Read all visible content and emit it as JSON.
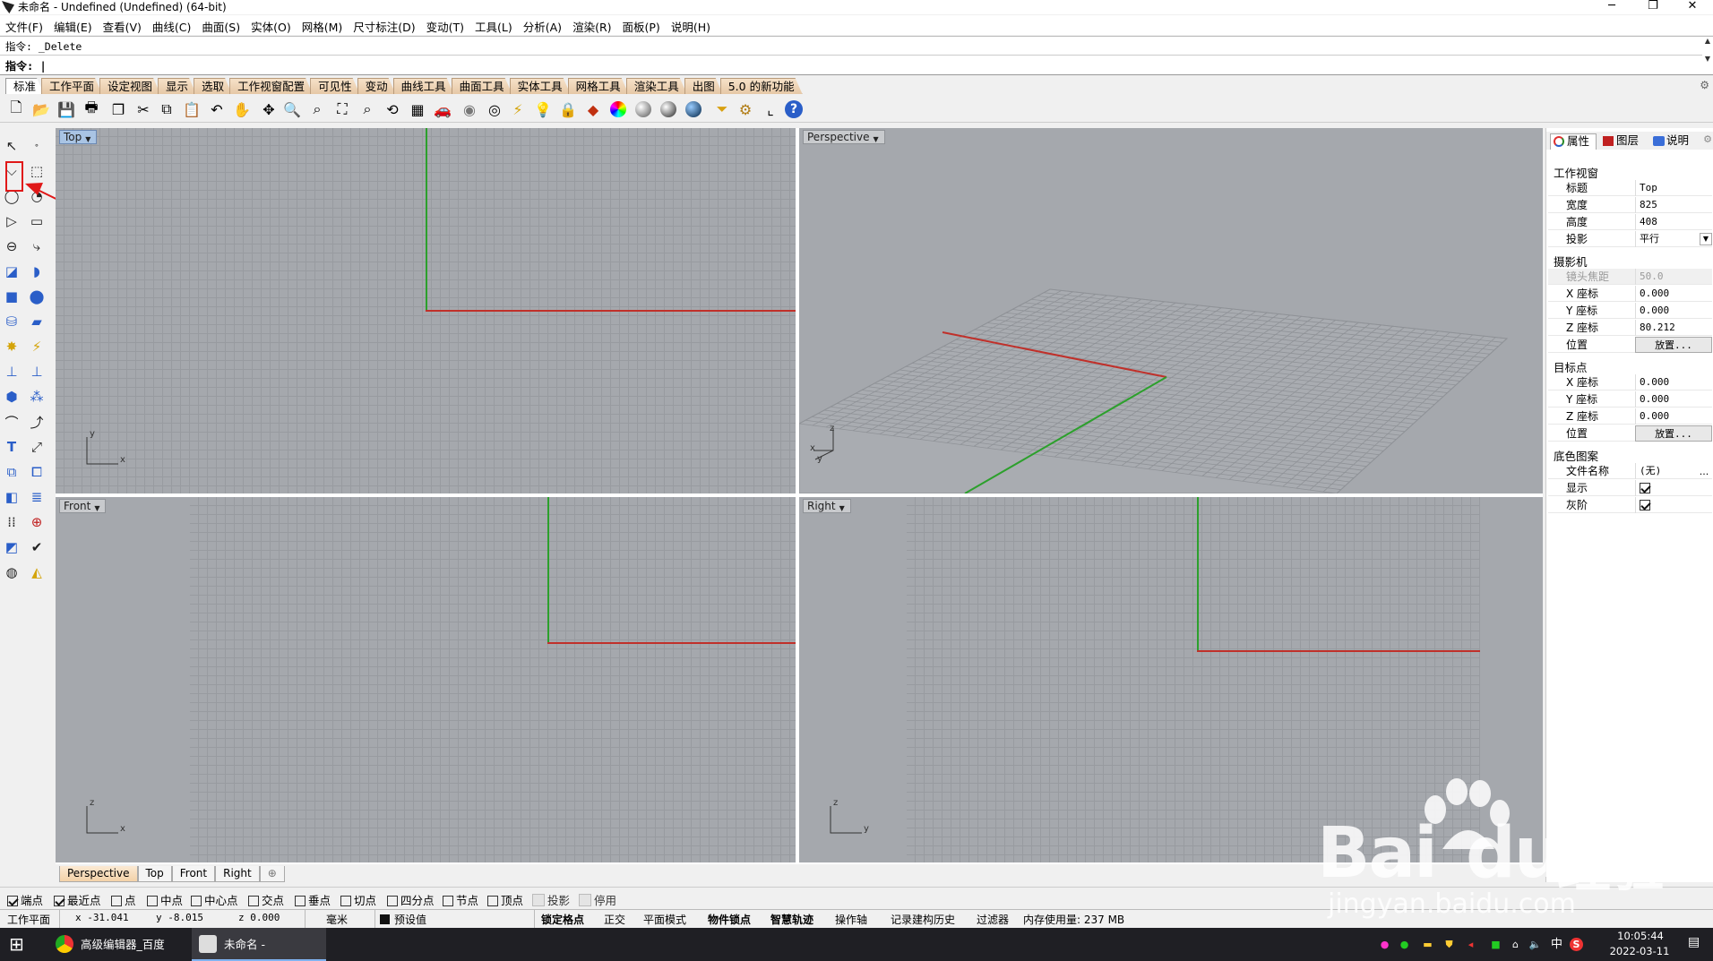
{
  "titlebar": {
    "title": "未命名 - Undefined (Undefined) (64-bit)",
    "minimize": "─",
    "maximize": "❐",
    "close": "✕"
  },
  "menu": [
    "文件(F)",
    "编辑(E)",
    "查看(V)",
    "曲线(C)",
    "曲面(S)",
    "实体(O)",
    "网格(M)",
    "尺寸标注(D)",
    "变动(T)",
    "工具(L)",
    "分析(A)",
    "渲染(R)",
    "面板(P)",
    "说明(H)"
  ],
  "command": {
    "history": "指令: _Delete",
    "prompt": "指令: |"
  },
  "toolbar_tabs": [
    "标准",
    "工作平面",
    "设定视图",
    "显示",
    "选取",
    "工作视窗配置",
    "可见性",
    "变动",
    "曲线工具",
    "曲面工具",
    "实体工具",
    "网格工具",
    "渲染工具",
    "出图",
    "5.0 的新功能"
  ],
  "toolbar_icons": [
    "new-file-icon",
    "open-folder-icon",
    "save-icon",
    "print-icon",
    "import-icon",
    "cut-icon",
    "copy-icon",
    "paste-icon",
    "undo-icon",
    "pan-hand-icon",
    "rotate-view-icon",
    "zoom-icon",
    "zoom-window-icon",
    "zoom-extents-icon",
    "zoom-selected-icon",
    "undo-view-icon",
    "four-viewports-icon",
    "car-icon",
    "hide-icon",
    "show-icon",
    "osnap-icon",
    "light-icon",
    "lock-icon",
    "layer-icon",
    "material-color-icon",
    "render-preview-icon",
    "render-icon",
    "render-blue-icon",
    "select-filter-icon",
    "options-gear-icon",
    "cplane-icon",
    "help-icon"
  ],
  "left_tools": [
    "select-arrow-icon",
    "point-icon",
    "polyline-icon",
    "control-points-curve-icon",
    "circle-icon",
    "arc-icon",
    "polygon-icon",
    "rectangle-icon",
    "ellipse-icon",
    "fillet-curve-icon",
    "surface-from-points-icon",
    "extrude-curve-icon",
    "box-icon",
    "sphere-group-icon",
    "cylinder-icon",
    "mesh-plane-icon",
    "boolean-union-icon",
    "explode-icon",
    "lineweight-icon",
    "dimension-icon",
    "split-icon",
    "join-icon",
    "fillet-icon",
    "chamfer-icon",
    "text-icon",
    "transform-icon",
    "array-icon",
    "group-icon",
    "block-icon",
    "layer-tool-icon",
    "grid-array-icon",
    "analyze-icon",
    "history-icon",
    "check-icon",
    "render-tool-icon",
    "light-tool-icon"
  ],
  "viewports": {
    "top": {
      "label": "Top",
      "axis_a": "y",
      "axis_b": "x"
    },
    "perspective": {
      "label": "Perspective",
      "axis_a": "z",
      "axis_b": "x",
      "axis_c": "y"
    },
    "front": {
      "label": "Front",
      "axis_a": "z",
      "axis_b": "x"
    },
    "right": {
      "label": "Right",
      "axis_a": "z",
      "axis_b": "y"
    }
  },
  "viewport_tabs": [
    "Perspective",
    "Top",
    "Front",
    "Right"
  ],
  "add_tab": "⊕",
  "panel": {
    "tabs": [
      "属性",
      "图层",
      "说明"
    ],
    "section_viewport": "工作视窗",
    "title_label": "标题",
    "title_value": "Top",
    "width_label": "宽度",
    "width_value": "825",
    "height_label": "高度",
    "height_value": "408",
    "projection_label": "投影",
    "projection_value": "平行",
    "section_camera": "摄影机",
    "lens_label": "镜头焦距",
    "lens_value": "50.0",
    "cam_x_label": "X 座标",
    "cam_x_value": "0.000",
    "cam_y_label": "Y 座标",
    "cam_y_value": "0.000",
    "cam_z_label": "Z 座标",
    "cam_z_value": "80.212",
    "cam_pos_label": "位置",
    "cam_pos_button": "放置...",
    "section_target": "目标点",
    "tgt_x_label": "X 座标",
    "tgt_x_value": "0.000",
    "tgt_y_label": "Y 座标",
    "tgt_y_value": "0.000",
    "tgt_z_label": "Z 座标",
    "tgt_z_value": "0.000",
    "tgt_pos_label": "位置",
    "tgt_pos_button": "放置...",
    "section_bg": "底色图案",
    "file_label": "文件名称",
    "file_value": "(无)",
    "file_button": "...",
    "show_label": "显示",
    "show_checked": true,
    "gray_label": "灰阶",
    "gray_checked": true
  },
  "osnaps": [
    {
      "label": "端点",
      "checked": true
    },
    {
      "label": "最近点",
      "checked": true
    },
    {
      "label": "点",
      "checked": false
    },
    {
      "label": "中点",
      "checked": false
    },
    {
      "label": "中心点",
      "checked": false
    },
    {
      "label": "交点",
      "checked": false
    },
    {
      "label": "垂点",
      "checked": false
    },
    {
      "label": "切点",
      "checked": false
    },
    {
      "label": "四分点",
      "checked": false
    },
    {
      "label": "节点",
      "checked": false
    },
    {
      "label": "顶点",
      "checked": false
    },
    {
      "label": "投影",
      "checked": false
    },
    {
      "label": "停用",
      "checked": false
    }
  ],
  "status": {
    "cplane": "工作平面",
    "x": "x -31.041",
    "y": "y -8.015",
    "z": "z 0.000",
    "unit": "毫米",
    "layer": "预设值",
    "grid_snap": "锁定格点",
    "ortho": "正交",
    "planar": "平面模式",
    "osnap": "物件锁点",
    "smarttrack": "智慧轨迹",
    "gumball": "操作轴",
    "history": "记录建构历史",
    "filter": "过滤器",
    "memory": "内存使用量: 237 MB"
  },
  "taskbar": {
    "start": "⊞",
    "app1": "高级编辑器_百度经...",
    "app2": "未命名 - Undefine...",
    "ime": "中",
    "time": "10:05:44",
    "date": "2022-03-11"
  },
  "watermark": {
    "brand": "Bai",
    "brand2": "du",
    "cn": "经验",
    "url": "jingyan.baidu.com"
  },
  "colors": {
    "viewport_bg": "#a5a8ad",
    "grid_line": "#989ba0",
    "x_axis": "#c0302a",
    "y_axis": "#2ca02c",
    "annotation": "#e01818"
  }
}
